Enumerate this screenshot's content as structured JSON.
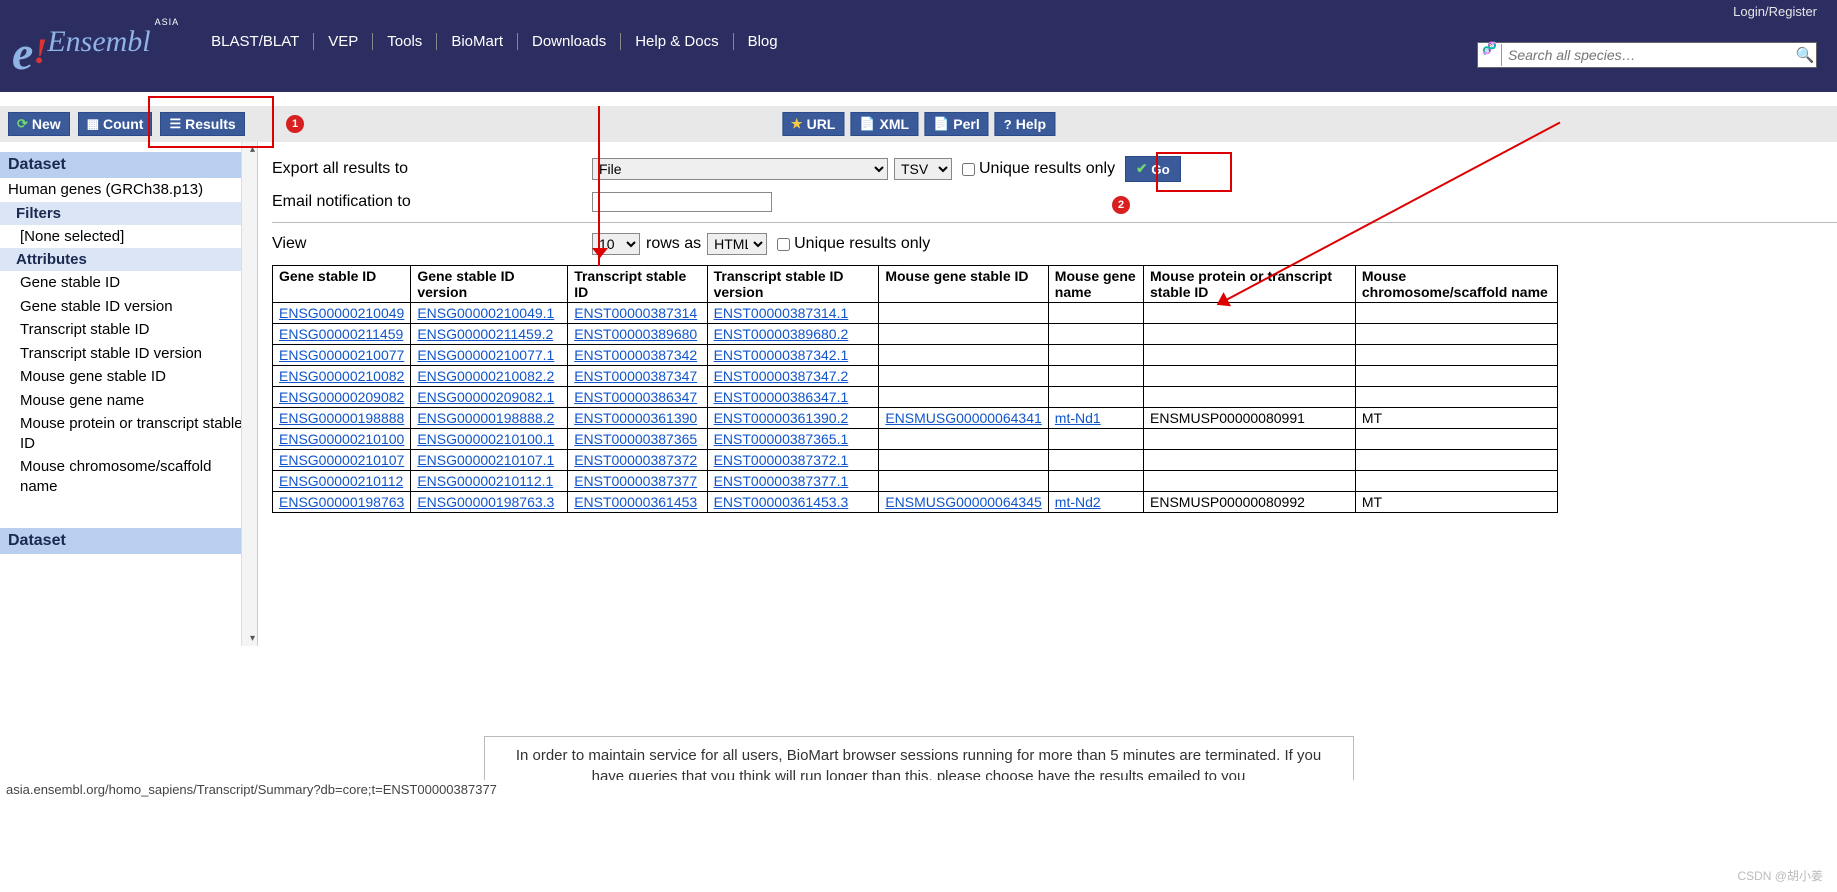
{
  "header": {
    "login": "Login/Register",
    "logo_text": "Ensembl",
    "logo_asia": "ASIA",
    "nav": [
      "BLAST/BLAT",
      "VEP",
      "Tools",
      "BioMart",
      "Downloads",
      "Help & Docs",
      "Blog"
    ],
    "search_placeholder": "Search all species…"
  },
  "toolbar": {
    "new": "New",
    "count": "Count",
    "results": "Results",
    "url": "URL",
    "xml": "XML",
    "perl": "Perl",
    "help": "Help"
  },
  "sidebar": {
    "dataset_head": "Dataset",
    "dataset_val": "Human genes (GRCh38.p13)",
    "filters_head": "Filters",
    "filters_none": "[None selected]",
    "attributes_head": "Attributes",
    "attributes": [
      "Gene stable ID",
      "Gene stable ID version",
      "Transcript stable ID",
      "Transcript stable ID version",
      "Mouse gene stable ID",
      "Mouse gene name",
      "Mouse protein or transcript stable ID",
      "Mouse chromosome/scaffold name"
    ],
    "dataset_head2": "Dataset"
  },
  "export": {
    "label": "Export  all results to",
    "dest": "File",
    "fmt": "TSV",
    "unique_label": "Unique results only",
    "go": "Go",
    "email_label": "Email notification to"
  },
  "view": {
    "label": "View",
    "count": "10",
    "rows_as": "rows as",
    "fmt": "HTML",
    "unique_label": "Unique results only"
  },
  "table": {
    "headers": [
      "Gene stable ID",
      "Gene stable ID version",
      "Transcript stable ID",
      "Transcript stable ID version",
      "Mouse gene stable ID",
      "Mouse gene name",
      "Mouse protein or transcript stable ID",
      "Mouse chromosome/scaffold name"
    ],
    "rows": [
      {
        "gsi": "ENSG00000210049",
        "gsiv": "ENSG00000210049.1",
        "tsi": "ENST00000387314",
        "tsiv": "ENST00000387314.1",
        "mgi": "",
        "mgn": "",
        "mpt": "",
        "mcs": ""
      },
      {
        "gsi": "ENSG00000211459",
        "gsiv": "ENSG00000211459.2",
        "tsi": "ENST00000389680",
        "tsiv": "ENST00000389680.2",
        "mgi": "",
        "mgn": "",
        "mpt": "",
        "mcs": ""
      },
      {
        "gsi": "ENSG00000210077",
        "gsiv": "ENSG00000210077.1",
        "tsi": "ENST00000387342",
        "tsiv": "ENST00000387342.1",
        "mgi": "",
        "mgn": "",
        "mpt": "",
        "mcs": ""
      },
      {
        "gsi": "ENSG00000210082",
        "gsiv": "ENSG00000210082.2",
        "tsi": "ENST00000387347",
        "tsiv": "ENST00000387347.2",
        "mgi": "",
        "mgn": "",
        "mpt": "",
        "mcs": ""
      },
      {
        "gsi": "ENSG00000209082",
        "gsiv": "ENSG00000209082.1",
        "tsi": "ENST00000386347",
        "tsiv": "ENST00000386347.1",
        "mgi": "",
        "mgn": "",
        "mpt": "",
        "mcs": ""
      },
      {
        "gsi": "ENSG00000198888",
        "gsiv": "ENSG00000198888.2",
        "tsi": "ENST00000361390",
        "tsiv": "ENST00000361390.2",
        "mgi": "ENSMUSG00000064341",
        "mgn": "mt-Nd1",
        "mpt": "ENSMUSP00000080991",
        "mcs": "MT"
      },
      {
        "gsi": "ENSG00000210100",
        "gsiv": "ENSG00000210100.1",
        "tsi": "ENST00000387365",
        "tsiv": "ENST00000387365.1",
        "mgi": "",
        "mgn": "",
        "mpt": "",
        "mcs": ""
      },
      {
        "gsi": "ENSG00000210107",
        "gsiv": "ENSG00000210107.1",
        "tsi": "ENST00000387372",
        "tsiv": "ENST00000387372.1",
        "mgi": "",
        "mgn": "",
        "mpt": "",
        "mcs": ""
      },
      {
        "gsi": "ENSG00000210112",
        "gsiv": "ENSG00000210112.1",
        "tsi": "ENST00000387377",
        "tsiv": "ENST00000387377.1",
        "mgi": "",
        "mgn": "",
        "mpt": "",
        "mcs": ""
      },
      {
        "gsi": "ENSG00000198763",
        "gsiv": "ENSG00000198763.3",
        "tsi": "ENST00000361453",
        "tsiv": "ENST00000361453.3",
        "mgi": "ENSMUSG00000064345",
        "mgn": "mt-Nd2",
        "mpt": "ENSMUSP00000080992",
        "mcs": "MT"
      }
    ]
  },
  "footer_note": "In order to maintain service for all users, BioMart browser sessions running for more than 5 minutes are terminated. If you have queries that you think will run longer than this, please choose have the results emailed to you",
  "status_url": "asia.ensembl.org/homo_sapiens/Transcript/Summary?db=core;t=ENST00000387377",
  "watermark": "CSDN @胡小姜",
  "annotations": {
    "marker1": "1",
    "marker2": "2"
  }
}
